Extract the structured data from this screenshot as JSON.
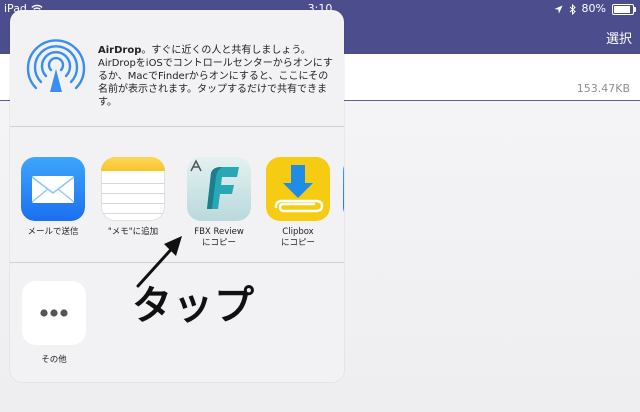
{
  "status_bar": {
    "carrier": "iPad",
    "time": "3:10",
    "battery_text": "80%",
    "battery_level": 0.8
  },
  "nav": {
    "select_label": "選択"
  },
  "file": {
    "size": "153.47KB"
  },
  "share_sheet": {
    "airdrop": {
      "title": "AirDrop",
      "description": "。すぐに近くの人と共有しましょう。AirDropをiOSでコントロールセンターからオンにするか、MacでFinderからオンにすると、ここにその名前が表示されます。タップするだけで共有できます。"
    },
    "apps": [
      {
        "icon": "mail-icon",
        "label": "メールで送信"
      },
      {
        "icon": "notes-icon",
        "label": "\"メモ\"に追加"
      },
      {
        "icon": "fbx-review-icon",
        "label_line1": "FBX Review",
        "label_line2": "にコピー"
      },
      {
        "icon": "clipbox-icon",
        "label_line1": "Clipbox",
        "label_line2": "にコピー"
      }
    ],
    "more": {
      "icon": "more-icon",
      "label": "その他"
    }
  },
  "annotation": {
    "text": "タップ"
  },
  "colors": {
    "nav_bg": "#4b4d8d",
    "sheet_bg": "#f2f2f4",
    "clipbox_yellow": "#f5cc12",
    "mail_blue": "#1b6ff0"
  }
}
